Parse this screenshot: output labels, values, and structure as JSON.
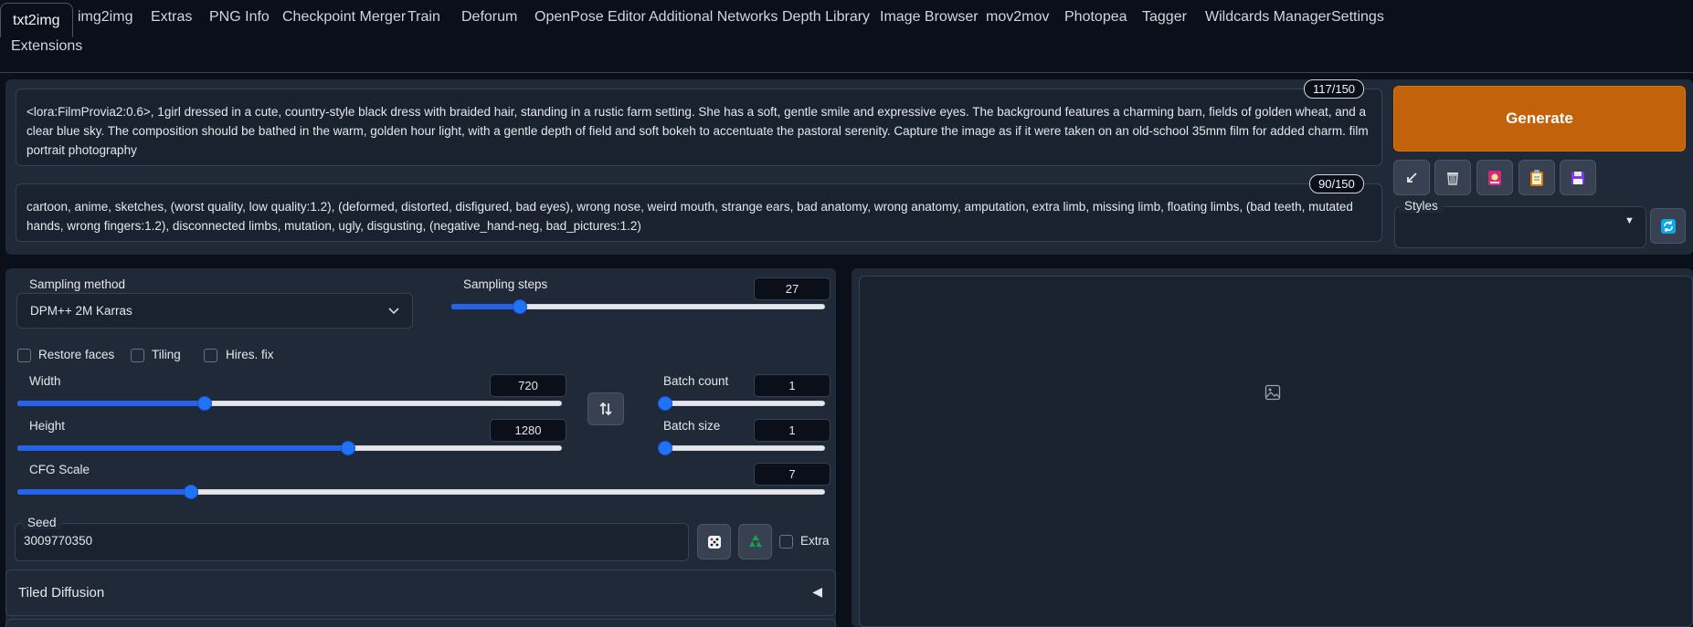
{
  "tabs": [
    {
      "label": "txt2img",
      "active": true
    },
    {
      "label": "img2img"
    },
    {
      "label": "Extras"
    },
    {
      "label": "PNG Info"
    },
    {
      "label": "Checkpoint Merger"
    },
    {
      "label": "Train"
    },
    {
      "label": "Deforum"
    },
    {
      "label": "OpenPose Editor"
    },
    {
      "label": "Additional Networks"
    },
    {
      "label": "Depth Library"
    },
    {
      "label": "Image Browser"
    },
    {
      "label": "mov2mov"
    },
    {
      "label": "Photopea"
    },
    {
      "label": "Tagger"
    },
    {
      "label": "Wildcards Manager"
    },
    {
      "label": "Settings"
    },
    {
      "label": "Extensions"
    }
  ],
  "prompt": {
    "positive": "<lora:FilmProvia2:0.6>, 1girl dressed in a cute, country-style black dress with braided hair, standing in a rustic farm setting. She has a soft, gentle smile and expressive eyes. The background features a charming barn, fields of golden wheat, and a clear blue sky. The composition should be bathed in the warm, golden hour light, with a gentle depth of field and soft bokeh to accentuate the pastoral serenity. Capture the image as if it were taken on an old-school 35mm film for added charm. film portrait photography",
    "positive_tokens": "117/150",
    "negative": "cartoon, anime, sketches, (worst quality, low quality:1.2), (deformed, distorted, disfigured, bad eyes), wrong nose, weird mouth, strange ears, bad anatomy, wrong anatomy, amputation, extra limb, missing limb, floating limbs, (bad teeth, mutated hands, wrong fingers:1.2), disconnected limbs, mutation, ugly, disgusting, (negative_hand-neg, bad_pictures:1.2)",
    "negative_tokens": "90/150"
  },
  "actions": {
    "generate_label": "Generate",
    "styles_label": "Styles"
  },
  "settings": {
    "sampling_method_label": "Sampling method",
    "sampling_method_value": "DPM++ 2M Karras",
    "sampling_steps_label": "Sampling steps",
    "sampling_steps_value": "27",
    "sampling_steps_fraction": 0.17,
    "restore_faces_label": "Restore faces",
    "tiling_label": "Tiling",
    "hires_fix_label": "Hires. fix",
    "width_label": "Width",
    "width_value": "720",
    "width_fraction": 0.34,
    "height_label": "Height",
    "height_value": "1280",
    "height_fraction": 0.61,
    "batch_count_label": "Batch count",
    "batch_count_value": "1",
    "batch_count_fraction": 0.0,
    "batch_size_label": "Batch size",
    "batch_size_value": "1",
    "batch_size_fraction": 0.0,
    "cfg_scale_label": "CFG Scale",
    "cfg_scale_value": "7",
    "cfg_scale_fraction": 0.21,
    "seed_label": "Seed",
    "seed_value": "3009770350",
    "extra_label": "Extra",
    "tiled_diffusion_label": "Tiled Diffusion"
  },
  "colors": {
    "accent": "#1d74f5",
    "generate": "#c2620a",
    "background": "#0b0f19",
    "panel": "#1f2937"
  },
  "icons": [
    "arrow-icon",
    "trash-icon",
    "extra-networks-icon",
    "clipboard-icon",
    "save-icon",
    "refresh-icon",
    "swap-icon",
    "dice-icon",
    "recycle-icon",
    "image-icon",
    "chevron-down-icon"
  ]
}
